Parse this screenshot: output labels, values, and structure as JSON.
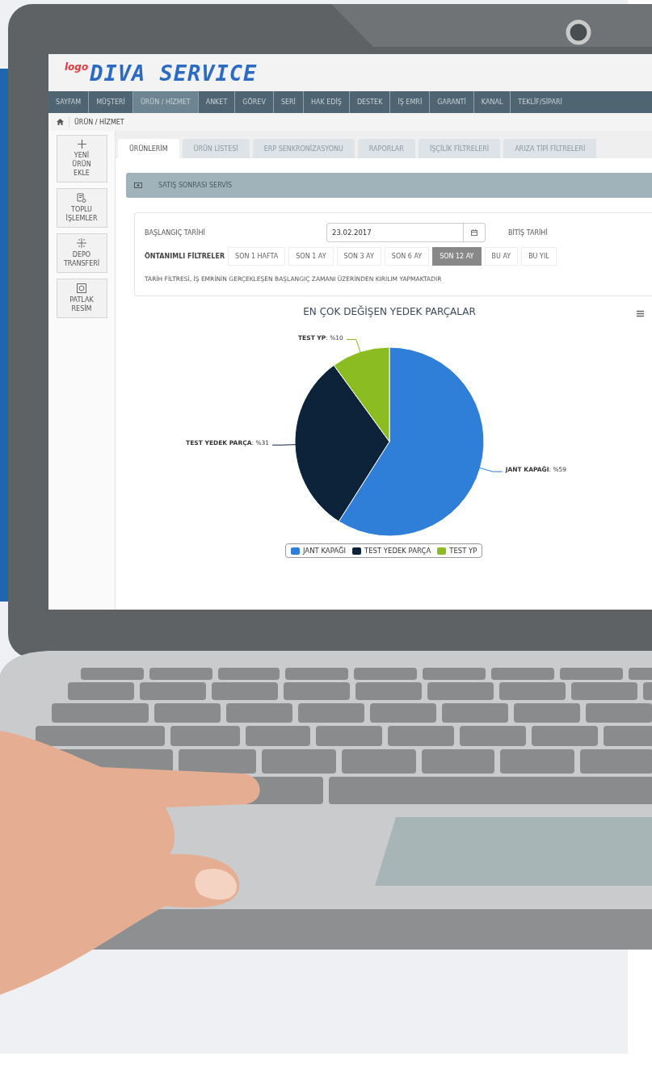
{
  "logo": {
    "brand": "logo",
    "product": "DIVA SERVICE"
  },
  "nav": [
    {
      "label": "SAYFAM",
      "selected": false
    },
    {
      "label": "MÜŞTERİ",
      "selected": false
    },
    {
      "label": "ÜRÜN / HİZMET",
      "selected": true
    },
    {
      "label": "ANKET",
      "selected": false
    },
    {
      "label": "GÖREV",
      "selected": false
    },
    {
      "label": "SERİ",
      "selected": false
    },
    {
      "label": "HAK EDİŞ",
      "selected": false
    },
    {
      "label": "DESTEK",
      "selected": false
    },
    {
      "label": "İŞ EMRİ",
      "selected": false
    },
    {
      "label": "GARANTİ",
      "selected": false
    },
    {
      "label": "KANAL",
      "selected": false
    },
    {
      "label": "TEKLİF/SİPARİ",
      "selected": false
    }
  ],
  "breadcrumb": "ÜRÜN / HİZMET",
  "sidebar": [
    {
      "label": "YENİ ÜRÜN EKLE",
      "kind": "plus"
    },
    {
      "label": "TOPLU İŞLEMLER",
      "kind": "batch"
    },
    {
      "label": "DEPO TRANSFERİ",
      "kind": "transfer"
    },
    {
      "label": "PATLAK RESİM",
      "kind": "picture"
    }
  ],
  "tabs": [
    {
      "label": "ÜRÜNLERİM",
      "selected": true
    },
    {
      "label": "ÜRÜN LİSTESİ",
      "selected": false
    },
    {
      "label": "ERP SENKRONİZASYONU",
      "selected": false
    },
    {
      "label": "RAPORLAR",
      "selected": false
    },
    {
      "label": "İŞÇİLİK FİLTRELERİ",
      "selected": false
    },
    {
      "label": "ARIZA TİPİ FİLTRELERİ",
      "selected": false
    }
  ],
  "panel": {
    "title": "SATIŞ SONRASI SERVİS"
  },
  "filters": {
    "start_label": "BAŞLANGIÇ TARİHİ",
    "start_value": "23.02.2017",
    "end_label": "BİTİŞ TARİHİ",
    "presets_label": "ÖNTANIMLI FİLTRELER",
    "presets": [
      {
        "label": "SON 1 HAFTA",
        "selected": false
      },
      {
        "label": "SON 1 AY",
        "selected": false
      },
      {
        "label": "SON 3 AY",
        "selected": false
      },
      {
        "label": "SON 6 AY",
        "selected": false
      },
      {
        "label": "SON 12 AY",
        "selected": true
      },
      {
        "label": "BU AY",
        "selected": false
      },
      {
        "label": "BU YIL",
        "selected": false
      }
    ],
    "note": "TARİH FİLTRESİ, İŞ EMRİNİN GERÇEKLEŞEN BAŞLANGIÇ ZAMANI ÜZERİNDEN KIRILIM YAPMAKTADIR"
  },
  "chart_data": {
    "type": "pie",
    "title": "EN ÇOK DEĞİŞEN YEDEK PARÇALAR",
    "categories": [
      "JANT KAPAĞI",
      "TEST YEDEK PARÇA",
      "TEST YP"
    ],
    "series": [
      {
        "values": [
          59,
          31,
          10
        ]
      }
    ],
    "legend": true,
    "colors": [
      "#2f7ed8",
      "#0d233a",
      "#8bbc21"
    ],
    "value_labels": [
      "**JANT KAPAĞI**: %59",
      "**TEST YEDEK PARÇA**: %31",
      "**TEST YP**: %10"
    ]
  }
}
